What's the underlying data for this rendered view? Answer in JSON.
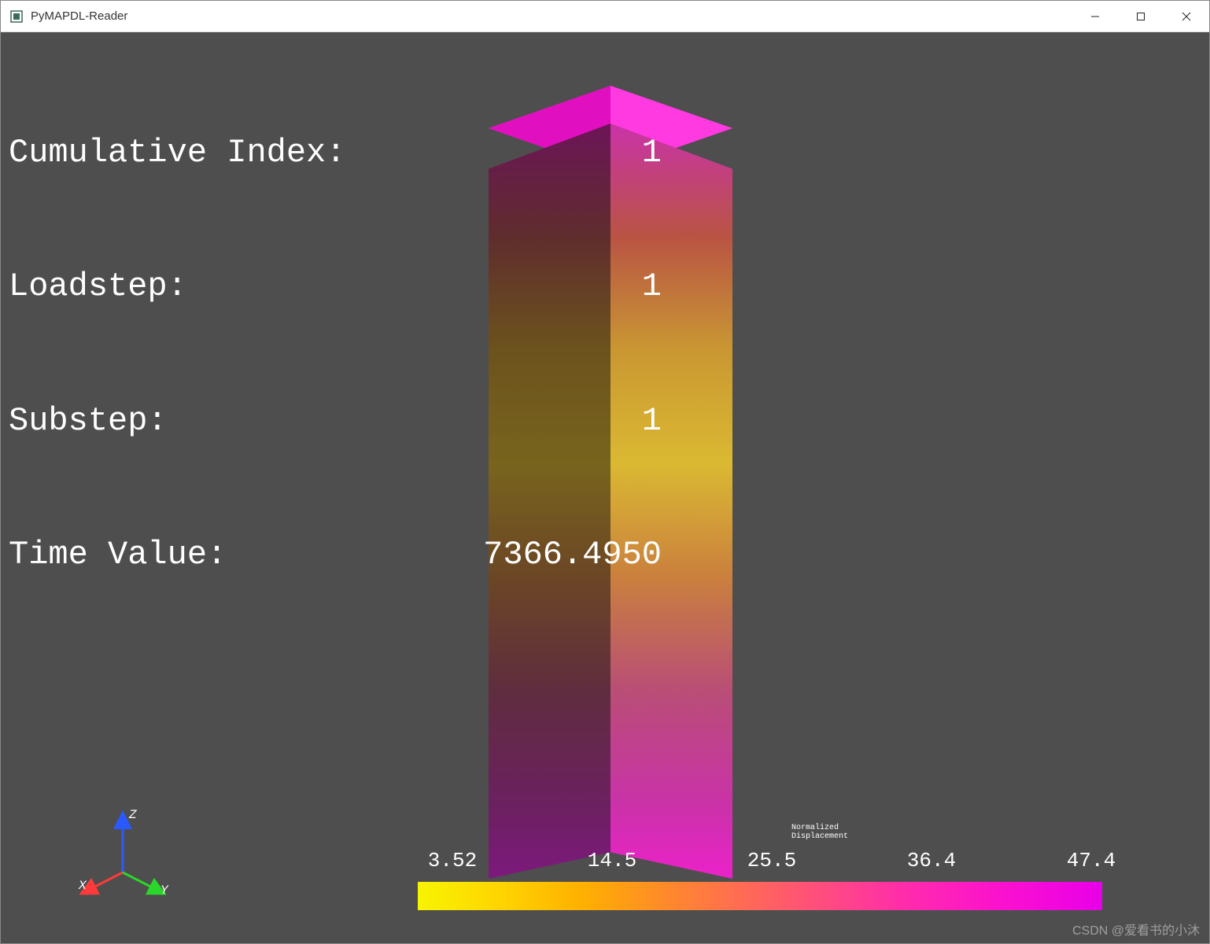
{
  "window": {
    "title": "PyMAPDL-Reader"
  },
  "overlay": {
    "rows": [
      {
        "label": "Cumulative Index:",
        "value": "1"
      },
      {
        "label": "Loadstep:",
        "value": "1"
      },
      {
        "label": "Substep:",
        "value": "1"
      },
      {
        "label": "Time Value:",
        "value": "7366.4950"
      }
    ]
  },
  "axes": {
    "x": "X",
    "y": "Y",
    "z": "Z"
  },
  "colorbar": {
    "title_line1": "Normalized",
    "title_line2": "Displacement",
    "ticks": [
      "3.52",
      "14.5",
      "25.5",
      "36.4",
      "47.4"
    ]
  },
  "watermark": "CSDN @爱看书的小沐",
  "chart_data": {
    "type": "heatmap",
    "title": "Normalized Displacement",
    "colorbar_range": [
      3.52,
      47.4
    ],
    "colorbar_ticks": [
      3.52,
      14.5,
      25.5,
      36.4,
      47.4
    ],
    "series": [
      {
        "name": "Cumulative Index",
        "value": 1
      },
      {
        "name": "Loadstep",
        "value": 1
      },
      {
        "name": "Substep",
        "value": 1
      },
      {
        "name": "Time Value",
        "value": 7366.495
      }
    ]
  }
}
